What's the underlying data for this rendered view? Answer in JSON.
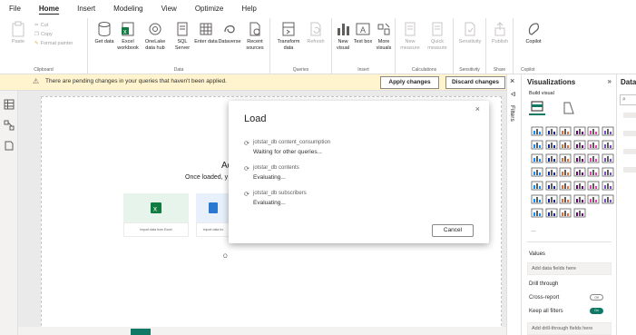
{
  "menu": [
    "File",
    "Home",
    "Insert",
    "Modeling",
    "View",
    "Optimize",
    "Help"
  ],
  "ribbon": {
    "clipboard": {
      "paste": "Paste",
      "cut": "Cut",
      "copy": "Copy",
      "format_painter": "Format painter",
      "label": "Clipboard"
    },
    "data": {
      "get_data": "Get data",
      "excel": "Excel workbook",
      "onelake": "OneLake data hub",
      "sql": "SQL Server",
      "enter": "Enter data",
      "dataverse": "Dataverse",
      "recent": "Recent sources",
      "label": "Data"
    },
    "queries": {
      "transform": "Transform data",
      "refresh": "Refresh",
      "label": "Queries"
    },
    "insert": {
      "new_visual": "New visual",
      "text_box": "Text box",
      "more_visuals": "More visuals",
      "label": "Insert"
    },
    "calculations": {
      "new_measure": "New measure",
      "quick_measure": "Quick measure",
      "label": "Calculations"
    },
    "sensitivity": {
      "sensitivity": "Sensitivity",
      "label": "Sensitivity"
    },
    "share": {
      "publish": "Publish",
      "label": "Share"
    },
    "copilot": {
      "copilot": "Copilot",
      "label": "Copilot"
    }
  },
  "notification": {
    "message": "There are pending changes in your queries that haven't been applied.",
    "apply": "Apply changes",
    "discard": "Discard changes"
  },
  "canvas": {
    "title": "Ad",
    "subtitle": "Once loaded, y",
    "cards": [
      "Import data from Excel",
      "Import data fro"
    ],
    "footer_char": "O"
  },
  "dialog": {
    "title": "Load",
    "close": "×",
    "items": [
      {
        "name": "jotstar_db content_consumption",
        "status": "Waiting for other queries..."
      },
      {
        "name": "jotstar_db contents",
        "status": "Evaluating..."
      },
      {
        "name": "jotstar_db subscribers",
        "status": "Evaluating..."
      }
    ],
    "cancel": "Cancel"
  },
  "filters": {
    "label": "Filters",
    "close": "×"
  },
  "visualizations": {
    "title": "Visualizations",
    "collapse": "»",
    "build_visual": "Build visual",
    "more": "...",
    "values": "Values",
    "add_fields": "Add data fields here",
    "drill_through": "Drill through",
    "cross_report": "Cross-report",
    "cross_report_state": "Off",
    "keep_filters": "Keep all filters",
    "keep_filters_state": "On",
    "add_drill": "Add drill-through fields here"
  },
  "data_pane": {
    "title": "Data",
    "search_icon": "⌕"
  },
  "colors": {
    "accent": "#f2c811",
    "notif_bg": "#fff4ce",
    "excel_green": "#107c41",
    "toggle_on": "#117865"
  }
}
